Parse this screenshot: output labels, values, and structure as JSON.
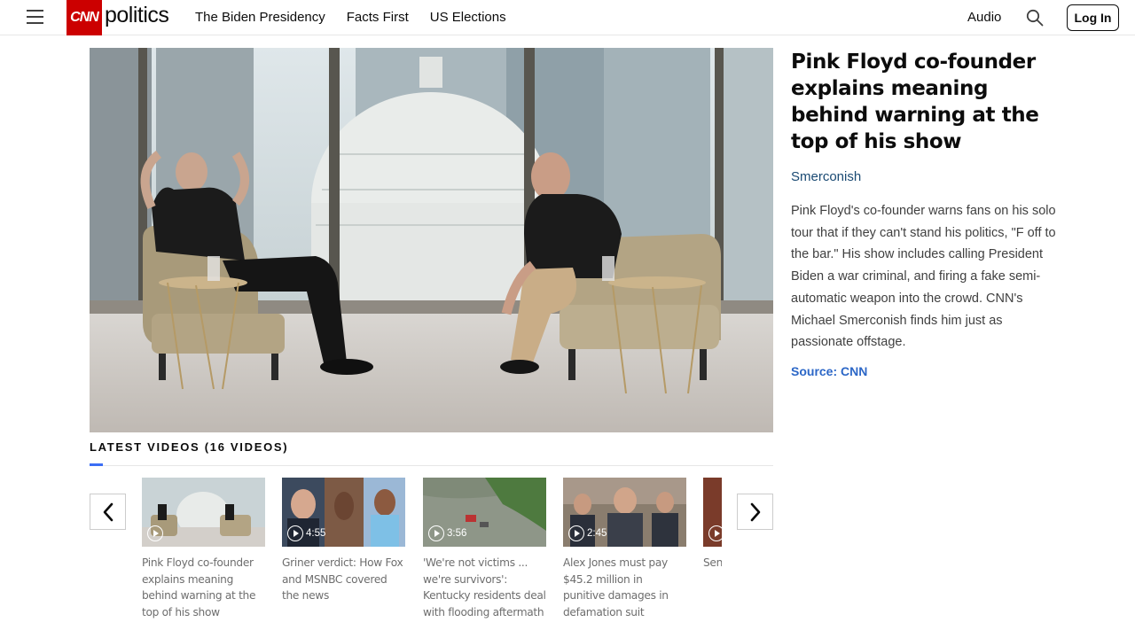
{
  "header": {
    "logo_text": "CNN",
    "section_name": "politics",
    "nav": [
      "The Biden Presidency",
      "Facts First",
      "US Elections"
    ],
    "audio_label": "Audio",
    "login_label": "Log In"
  },
  "article": {
    "headline": "Pink Floyd co-founder explains meaning behind warning at the top of his show",
    "show": "Smerconish",
    "description": "Pink Floyd's co-founder warns fans on his solo tour that if they can't stand his politics, \"F off to the bar.\" His show includes calling President Biden a war criminal, and firing a fake semi-automatic weapon into the crowd. CNN's Michael Smerconish finds him just as passionate offstage.",
    "source": "Source: CNN"
  },
  "latest": {
    "title": "LATEST VIDEOS (16 VIDEOS)",
    "videos": [
      {
        "caption": "Pink Floyd co-founder explains meaning behind warning at the top of his show",
        "duration": ""
      },
      {
        "caption": "Griner verdict: How Fox and MSNBC covered the news",
        "duration": "4:55"
      },
      {
        "caption": "'We're not victims ... we're survivors': Kentucky residents deal with flooding aftermath",
        "duration": "3:56"
      },
      {
        "caption": "Alex Jones must pay $45.2 million in punitive damages in defamation suit",
        "duration": "2:45"
      },
      {
        "caption": "Sen Linc abo",
        "duration": ""
      }
    ]
  },
  "icons": {
    "menu": "hamburger-icon",
    "search": "search-icon",
    "prev": "chevron-left-icon",
    "next": "chevron-right-icon",
    "play": "play-icon"
  },
  "colors": {
    "brand_red": "#cc0000",
    "show_link": "#1a4a73",
    "source_link": "#2c67c7",
    "accent": "#3b6ef5"
  }
}
